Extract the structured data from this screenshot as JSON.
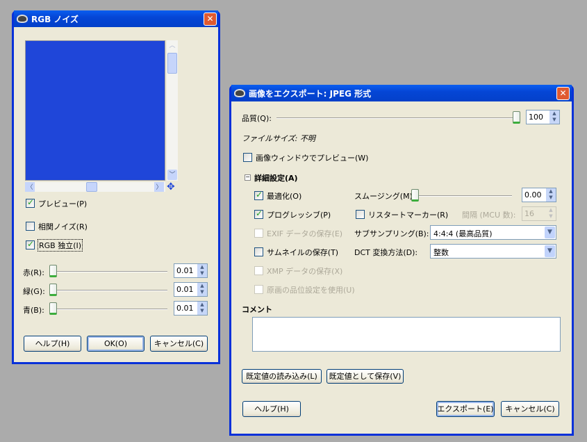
{
  "rgb_noise": {
    "title": "RGB ノイズ",
    "preview_color": "#1f46d9",
    "preview_label": "プレビュー(P)",
    "preview_checked": true,
    "correlated_label": "相関ノイズ(R)",
    "correlated_checked": false,
    "independent_label": "RGB 独立(I)",
    "independent_checked": true,
    "channels": [
      {
        "label": "赤(R):",
        "value": "0.01"
      },
      {
        "label": "緑(G):",
        "value": "0.01"
      },
      {
        "label": "青(B):",
        "value": "0.01"
      }
    ],
    "buttons": {
      "help": "ヘルプ(H)",
      "ok": "OK(O)",
      "cancel": "キャンセル(C)"
    }
  },
  "jpeg_export": {
    "title": "画像をエクスポート: JPEG 形式",
    "quality_label": "品質(Q):",
    "quality_value": "100",
    "file_size": "ファイルサイズ: 不明",
    "preview_in_window": "画像ウィンドウでプレビュー(W)",
    "advanced_label": "詳細設定(A)",
    "optimize": "最適化(O)",
    "progressive": "プログレッシブ(P)",
    "exif": "EXIF データの保存(E)",
    "thumbnail": "サムネイルの保存(T)",
    "xmp": "XMP データの保存(X)",
    "original_quality": "原画の品位設定を使用(U)",
    "smoothing_label": "スムージング(M):",
    "smoothing_value": "0.00",
    "restart_label": "リスタートマーカー(R)",
    "interval_label": "間隔 (MCU 数):",
    "interval_value": "16",
    "subsampling_label": "サブサンプリング(B):",
    "subsampling_value": "4:4:4 (最高品質)",
    "dct_label": "DCT 変換方法(D):",
    "dct_value": "整数",
    "comment_label": "コメント",
    "comment_value": "",
    "load_defaults": "既定値の読み込み(L)",
    "save_defaults": "既定値として保存(V)",
    "help": "ヘルプ(H)",
    "export": "エクスポート(E)",
    "cancel": "キャンセル(C)"
  }
}
